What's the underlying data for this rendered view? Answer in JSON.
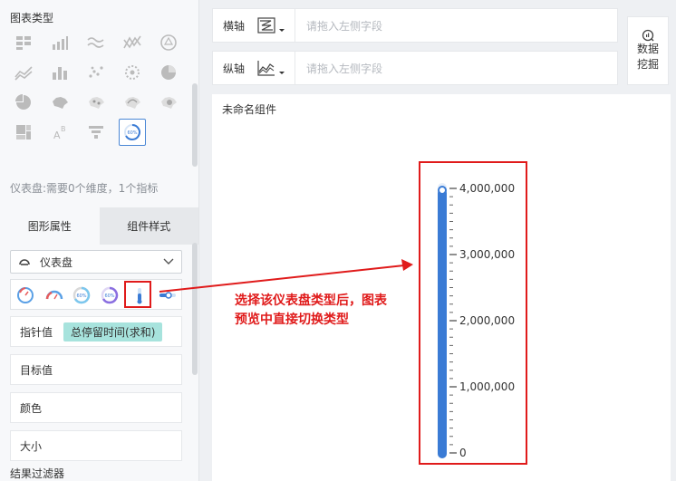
{
  "left_panel": {
    "chart_type_title": "图表类型",
    "chart_types": [
      "table-icon",
      "grouped-bar-icon",
      "wave-line-icon",
      "cross-line-icon",
      "dashboard-circle-icon",
      "area-line-icon",
      "bar-chart-icon",
      "scatter-icon",
      "bubble-icon",
      "pie-icon",
      "quarter-pie-icon",
      "china-map-icon",
      "dot-map-icon",
      "flow-map-icon",
      "heat-map-icon",
      "treemap-icon",
      "word-cloud-icon",
      "funnel-icon",
      "gauge-icon"
    ],
    "selected_type_index": 18,
    "gauge_desc": "仪表盘:需要0个维度，1个指标",
    "tabs": [
      "图形属性",
      "组件样式"
    ],
    "active_tab": 0,
    "gauge_select": {
      "value": "仪表盘"
    },
    "gauge_styles": [
      "speedometer-icon",
      "semicircle-gauge-icon",
      "ring-60-icon",
      "ring-60-blue-icon",
      "thermometer-icon",
      "slider-icon"
    ],
    "selected_gauge_style": 4,
    "fields": {
      "pointer_label": "指针值",
      "pointer_value": "总停留时间(求和)",
      "target_label": "目标值",
      "color_label": "颜色",
      "size_label": "大小"
    },
    "footer_section": "结果过滤器"
  },
  "toolbar": {
    "x_axis": {
      "label": "横轴",
      "placeholder": "请拖入左侧字段"
    },
    "y_axis": {
      "label": "纵轴",
      "placeholder": "请拖入左侧字段"
    },
    "mining": {
      "line1": "数据",
      "line2": "挖掘"
    }
  },
  "canvas": {
    "component_title": "未命名组件"
  },
  "annotation": {
    "text": "选择该仪表盘类型后，图表预览中直接切换类型",
    "color": "#e01b1b"
  },
  "colors": {
    "accent": "#3a7bd5",
    "highlight": "#e01b1b",
    "pill": "#a7e3dd"
  },
  "chart_data": {
    "type": "bar",
    "title": "",
    "categories": [
      ""
    ],
    "values": [
      4000000
    ],
    "ylim": [
      0,
      4000000
    ],
    "ticks": [
      {
        "value": 4000000,
        "label": "4,000,000"
      },
      {
        "value": 3000000,
        "label": "3,000,000"
      },
      {
        "value": 2000000,
        "label": "2,000,000"
      },
      {
        "value": 1000000,
        "label": "1,000,000"
      },
      {
        "value": 0,
        "label": "0"
      }
    ],
    "minor_per_major": 8,
    "style": "thermometer"
  }
}
